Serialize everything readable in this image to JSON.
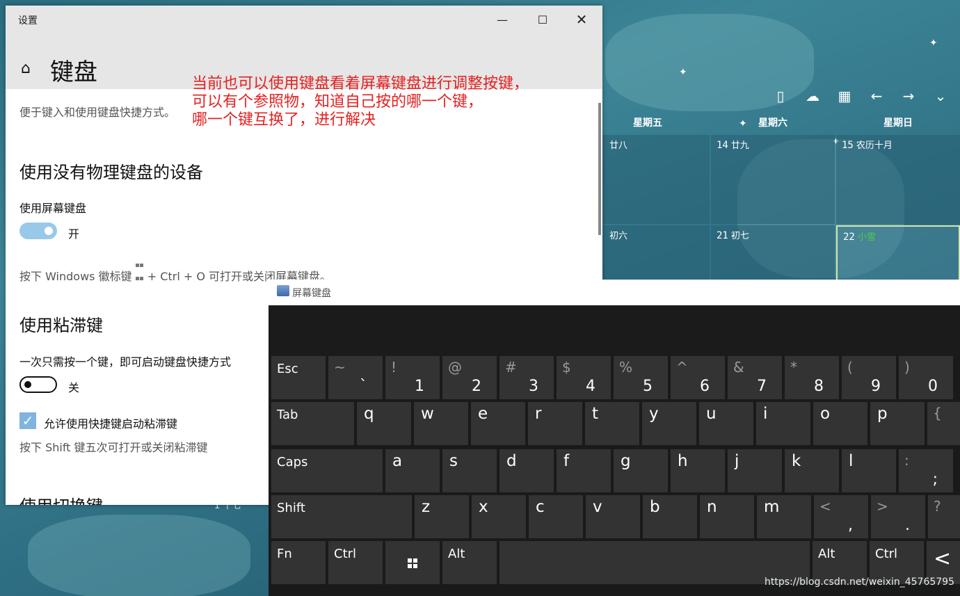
{
  "settings": {
    "window_title": "设置",
    "page_title": "键盘",
    "intro": "便于键入和使用键盘快捷方式。",
    "section1_title": "使用没有物理键盘的设备",
    "osk_label": "使用屏幕键盘",
    "osk_state": "开",
    "osk_hint_pre": "按下 Windows 徽标键",
    "osk_hint_post": "+ Ctrl + O 可打开或关闭屏幕键盘。",
    "section2_title": "使用粘滞键",
    "sticky_label": "一次只需按一个键，即可启动键盘快捷方式",
    "sticky_state": "关",
    "sticky_shortcut_label": "允许使用快捷键启动粘滞键",
    "sticky_hint": "按下 Shift 键五次可打开或关闭粘滞键",
    "section3_title": "使用切换键"
  },
  "annotation": {
    "line1": "当前也可以使用键盘看着屏幕键盘进行调整按键，",
    "line2": "可以有个参照物，知道自己按的哪一个键，",
    "line3": "哪一个键互换了，进行解决"
  },
  "calendar": {
    "weekdays": [
      "星期五",
      "星期六",
      "星期日"
    ],
    "row1": [
      {
        "day": "",
        "lunar": "廿八"
      },
      {
        "day": "14",
        "lunar": "廿九"
      },
      {
        "day": "15",
        "lunar": "农历十月"
      }
    ],
    "row2": [
      {
        "day": "",
        "lunar": "初六"
      },
      {
        "day": "21",
        "lunar": "初七"
      },
      {
        "day": "22",
        "lunar": "小雪"
      }
    ],
    "partial_text": "十七"
  },
  "osk": {
    "title": "屏幕键盘",
    "rows": {
      "row1": [
        {
          "label": "Esc"
        },
        {
          "sym": "~",
          "digit": "`"
        },
        {
          "sym": "!",
          "digit": "1"
        },
        {
          "sym": "@",
          "digit": "2"
        },
        {
          "sym": "#",
          "digit": "3"
        },
        {
          "sym": "$",
          "digit": "4"
        },
        {
          "sym": "%",
          "digit": "5"
        },
        {
          "sym": "^",
          "digit": "6"
        },
        {
          "sym": "&",
          "digit": "7"
        },
        {
          "sym": "*",
          "digit": "8"
        },
        {
          "sym": "(",
          "digit": "9"
        },
        {
          "sym": ")",
          "digit": "0"
        }
      ],
      "row2": [
        {
          "label": "Tab"
        },
        {
          "letter": "q"
        },
        {
          "letter": "w"
        },
        {
          "letter": "e"
        },
        {
          "letter": "r"
        },
        {
          "letter": "t"
        },
        {
          "letter": "y"
        },
        {
          "letter": "u"
        },
        {
          "letter": "i"
        },
        {
          "letter": "o"
        },
        {
          "letter": "p"
        },
        {
          "sym": "{",
          "digit": "["
        }
      ],
      "row3": [
        {
          "label": "Caps"
        },
        {
          "letter": "a"
        },
        {
          "letter": "s"
        },
        {
          "letter": "d"
        },
        {
          "letter": "f"
        },
        {
          "letter": "g"
        },
        {
          "letter": "h"
        },
        {
          "letter": "j"
        },
        {
          "letter": "k"
        },
        {
          "letter": "l"
        },
        {
          "sym": ":",
          "digit": ";"
        }
      ],
      "row4": [
        {
          "label": "Shift"
        },
        {
          "letter": "z"
        },
        {
          "letter": "x"
        },
        {
          "letter": "c"
        },
        {
          "letter": "v"
        },
        {
          "letter": "b"
        },
        {
          "letter": "n"
        },
        {
          "letter": "m"
        },
        {
          "sym": "<",
          "digit": ","
        },
        {
          "sym": ">",
          "digit": "."
        },
        {
          "sym": "?",
          "digit": "/"
        }
      ],
      "row5": [
        {
          "label": "Fn"
        },
        {
          "label": "Ctrl"
        },
        {
          "icon": "windows-icon"
        },
        {
          "label": "Alt"
        },
        {
          "label": ""
        },
        {
          "label": "Alt"
        },
        {
          "label": "Ctrl"
        },
        {
          "icon": "chevron-left-icon",
          "glyph": "<"
        }
      ]
    }
  },
  "watermark": "https://blog.csdn.net/weixin_45765795"
}
